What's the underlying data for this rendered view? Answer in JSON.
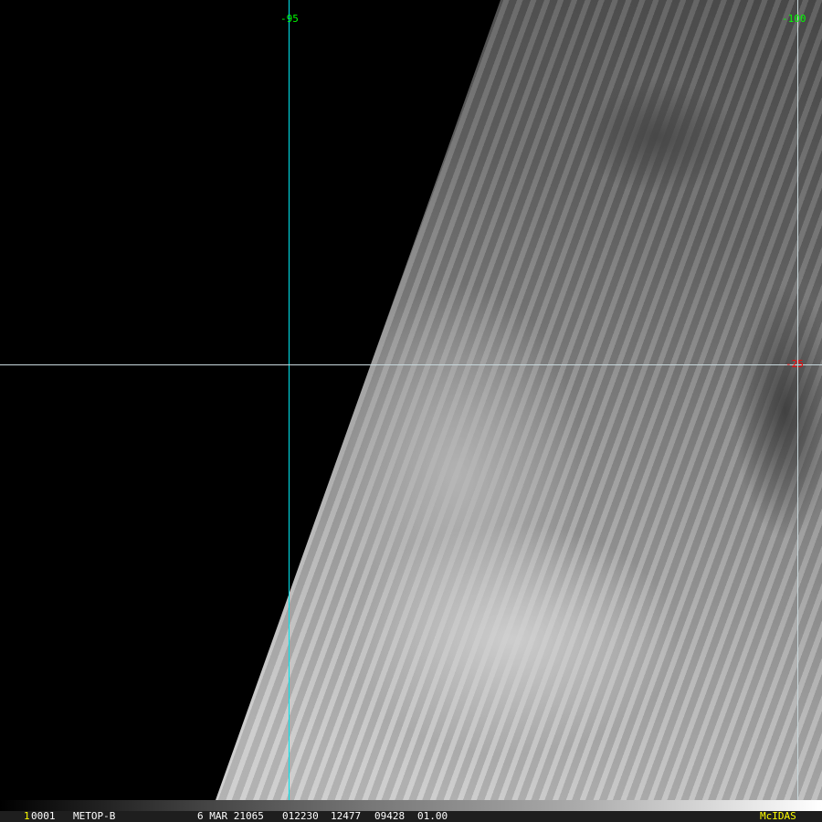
{
  "grid": {
    "lon_labels": [
      "-95",
      "-100"
    ],
    "lat_labels": [
      "-25"
    ],
    "colors": {
      "lon_line": "#00e5ee",
      "lat_line": "#c8d8dc",
      "lon_label": "#00ff00",
      "lat_label": "#ff0000"
    }
  },
  "status": {
    "frame": "1",
    "id": "0001",
    "satellite": "METOP-B",
    "date": "6 MAR 21065",
    "time": "012230",
    "line": "12477",
    "element": "09428",
    "res": "01.00",
    "brand": "McIDAS"
  }
}
